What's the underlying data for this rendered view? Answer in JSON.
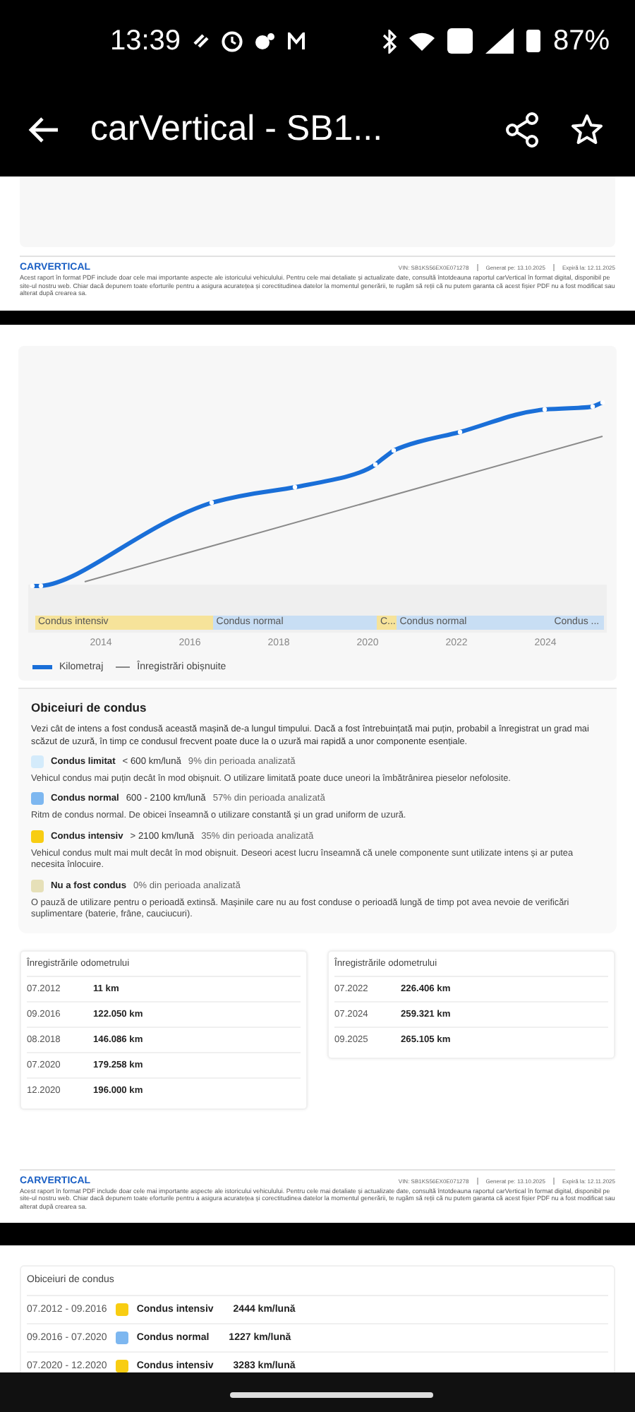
{
  "status_bar": {
    "time": "13:39",
    "battery": "87%"
  },
  "app_bar": {
    "title": "carVertical - SB1..."
  },
  "footers": [
    {
      "logo": "CARVERTICAL",
      "vin": "VIN: SB1KS56EX0E071278",
      "generated": "Generat pe: 13.10.2025",
      "expires": "Expiră la: 12.11.2025",
      "disclaimer": "Acest raport în format PDF include doar cele mai importante aspecte ale istoricului vehiculului. Pentru cele mai detaliate și actualizate date, consultă întotdeauna raportul carVertical în format digital, disponibil pe site-ul nostru web. Chiar dacă depunem toate eforturile pentru a asigura acuratețea și corectitudinea datelor la momentul generării, te rugăm să reții că nu putem garanta că acest fișier PDF nu a fost modificat sau alterat după crearea sa."
    },
    {
      "logo": "CARVERTICAL",
      "vin": "VIN: SB1KS56EX0E071278",
      "generated": "Generat pe: 13.10.2025",
      "expires": "Expiră la: 12.11.2025",
      "disclaimer": "Acest raport în format PDF include doar cele mai importante aspecte ale istoricului vehiculului. Pentru cele mai detaliate și actualizate date, consultă întotdeauna raportul carVertical în format digital, disponibil pe site-ul nostru web. Chiar dacă depunem toate eforturile pentru a asigura acuratețea și corectitudinea datelor la momentul generării, te rugăm să reții că nu putem garanta că acest fișier PDF nu a fost modificat sau alterat după crearea sa."
    }
  ],
  "chart": {
    "bands": [
      {
        "label": "Condus intensiv",
        "kind": "intensive"
      },
      {
        "label": "Condus normal",
        "kind": "normal"
      },
      {
        "label": "C...",
        "kind": "intensive"
      },
      {
        "label": "Condus normal",
        "kind": "normal"
      },
      {
        "label": "Condus ...",
        "kind": "normal"
      }
    ],
    "x_labels": [
      "2014",
      "2016",
      "2018",
      "2020",
      "2022",
      "2024"
    ],
    "legend": [
      "Kilometraj",
      "Înregistrări obișnuite"
    ]
  },
  "habits": {
    "title": "Obiceiuri de condus",
    "intro": "Vezi cât de intens a fost condusă această mașină de-a lungul timpului. Dacă a fost întrebuințată mai puțin, probabil a înregistrat un grad mai scăzut de uzură, în timp ce condusul frecvent poate duce la o uzură mai rapidă a unor componente esențiale.",
    "items": [
      {
        "kind": "limited",
        "name": "Condus limitat",
        "range": "< 600 km/lună",
        "share": "9% din perioada analizată",
        "description": "Vehicul condus mai puțin decât în mod obișnuit. O utilizare limitată poate duce uneori la îmbătrânirea pieselor nefolosite."
      },
      {
        "kind": "normal",
        "name": "Condus normal",
        "range": "600 - 2100 km/lună",
        "share": "57% din perioada analizată",
        "description": "Ritm de condus normal. De obicei înseamnă o utilizare constantă și un grad uniform de uzură."
      },
      {
        "kind": "intensive",
        "name": "Condus intensiv",
        "range": "> 2100 km/lună",
        "share": "35% din perioada analizată",
        "description": "Vehicul condus mult mai mult decât în mod obișnuit. Deseori acest lucru înseamnă că unele componente sunt utilizate intens și ar putea necesita înlocuire."
      },
      {
        "kind": "idle",
        "name": "Nu a fost condus",
        "share": "0% din perioada analizată",
        "description": "O pauză de utilizare pentru o perioadă extinsă. Mașinile care nu au fost conduse o perioadă lungă de timp pot avea nevoie de verificări suplimentare (baterie, frâne, cauciucuri)."
      }
    ]
  },
  "odometer_tables": [
    {
      "title": "Înregistrările odometrului",
      "rows": [
        {
          "date": "07.2012",
          "km": "11 km"
        },
        {
          "date": "09.2016",
          "km": "122.050 km"
        },
        {
          "date": "08.2018",
          "km": "146.086 km"
        },
        {
          "date": "07.2020",
          "km": "179.258 km"
        },
        {
          "date": "12.2020",
          "km": "196.000 km"
        }
      ]
    },
    {
      "title": "Înregistrările odometrului",
      "rows": [
        {
          "date": "07.2022",
          "km": "226.406 km"
        },
        {
          "date": "07.2024",
          "km": "259.321 km"
        },
        {
          "date": "09.2025",
          "km": "265.105 km"
        }
      ]
    }
  ],
  "periods": {
    "title": "Obiceiuri de condus",
    "rows": [
      {
        "dates": "07.2012 - 09.2016",
        "kind": "intensive",
        "label": "Condus intensiv",
        "rate": "2444 km/lună"
      },
      {
        "dates": "09.2016 - 07.2020",
        "kind": "normal",
        "label": "Condus normal",
        "rate": "1227 km/lună"
      },
      {
        "dates": "07.2020 - 12.2020",
        "kind": "intensive",
        "label": "Condus intensiv",
        "rate": "3283 km/lună"
      }
    ]
  }
}
